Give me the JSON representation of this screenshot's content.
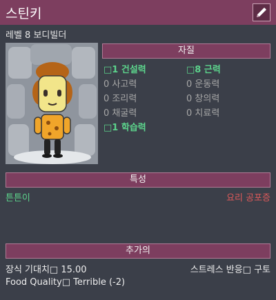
{
  "window": {
    "title": "스틴키"
  },
  "subtitle": "레벨 8 보디빌더",
  "aptitude": {
    "header": "자질",
    "attributes": [
      {
        "value": "□1",
        "name": "건설력",
        "positive": true
      },
      {
        "value": "□8",
        "name": "근력",
        "positive": true
      },
      {
        "value": "0",
        "name": "사고력",
        "positive": false
      },
      {
        "value": "0",
        "name": "운동력",
        "positive": false
      },
      {
        "value": "0",
        "name": "조리력",
        "positive": false
      },
      {
        "value": "0",
        "name": "창의력",
        "positive": false
      },
      {
        "value": "0",
        "name": "채굴력",
        "positive": false
      },
      {
        "value": "0",
        "name": "치료력",
        "positive": false
      },
      {
        "value": "□1",
        "name": "학습력",
        "positive": true
      }
    ]
  },
  "traits": {
    "header": "특성",
    "positive": "튼튼이",
    "negative": "요리 공포증"
  },
  "extra": {
    "header": "추가의",
    "decor_expectation": "장식 기대치□ 15.00",
    "stress_response": "스트레스 반응□ 구토",
    "food_quality": "Food Quality□ Terrible (-2)"
  },
  "colors": {
    "header_bg": "#7d3e5f",
    "positive": "#5cd48c",
    "negative": "#e05a5a",
    "panel_bg": "#3b3f49"
  },
  "icons": {
    "edit": "pencil-icon"
  }
}
